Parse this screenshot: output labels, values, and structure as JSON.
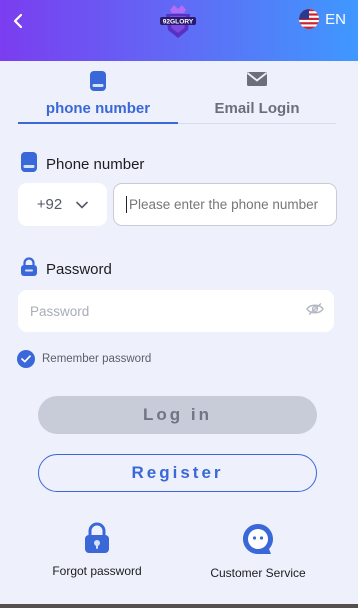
{
  "header": {
    "lang_label": "EN",
    "logo_text": "92GLORY"
  },
  "tabs": [
    {
      "label": "phone number",
      "icon": "phone-icon",
      "active": true
    },
    {
      "label": "Email Login",
      "icon": "mail-icon",
      "active": false
    }
  ],
  "phone": {
    "label": "Phone number",
    "country_code": "+92",
    "placeholder": "Please enter the phone number",
    "value": ""
  },
  "password": {
    "label": "Password",
    "placeholder": "Password",
    "value": ""
  },
  "remember": {
    "label": "Remember password",
    "checked": true
  },
  "buttons": {
    "login": "Log in",
    "register": "Register"
  },
  "bottom": {
    "forgot": "Forgot password",
    "service": "Customer Service"
  },
  "colors": {
    "accent": "#3a68d8",
    "header_gradient": [
      "#7b3df0",
      "#5d6ff6",
      "#3f98ff"
    ],
    "background": "#eef1fb"
  }
}
